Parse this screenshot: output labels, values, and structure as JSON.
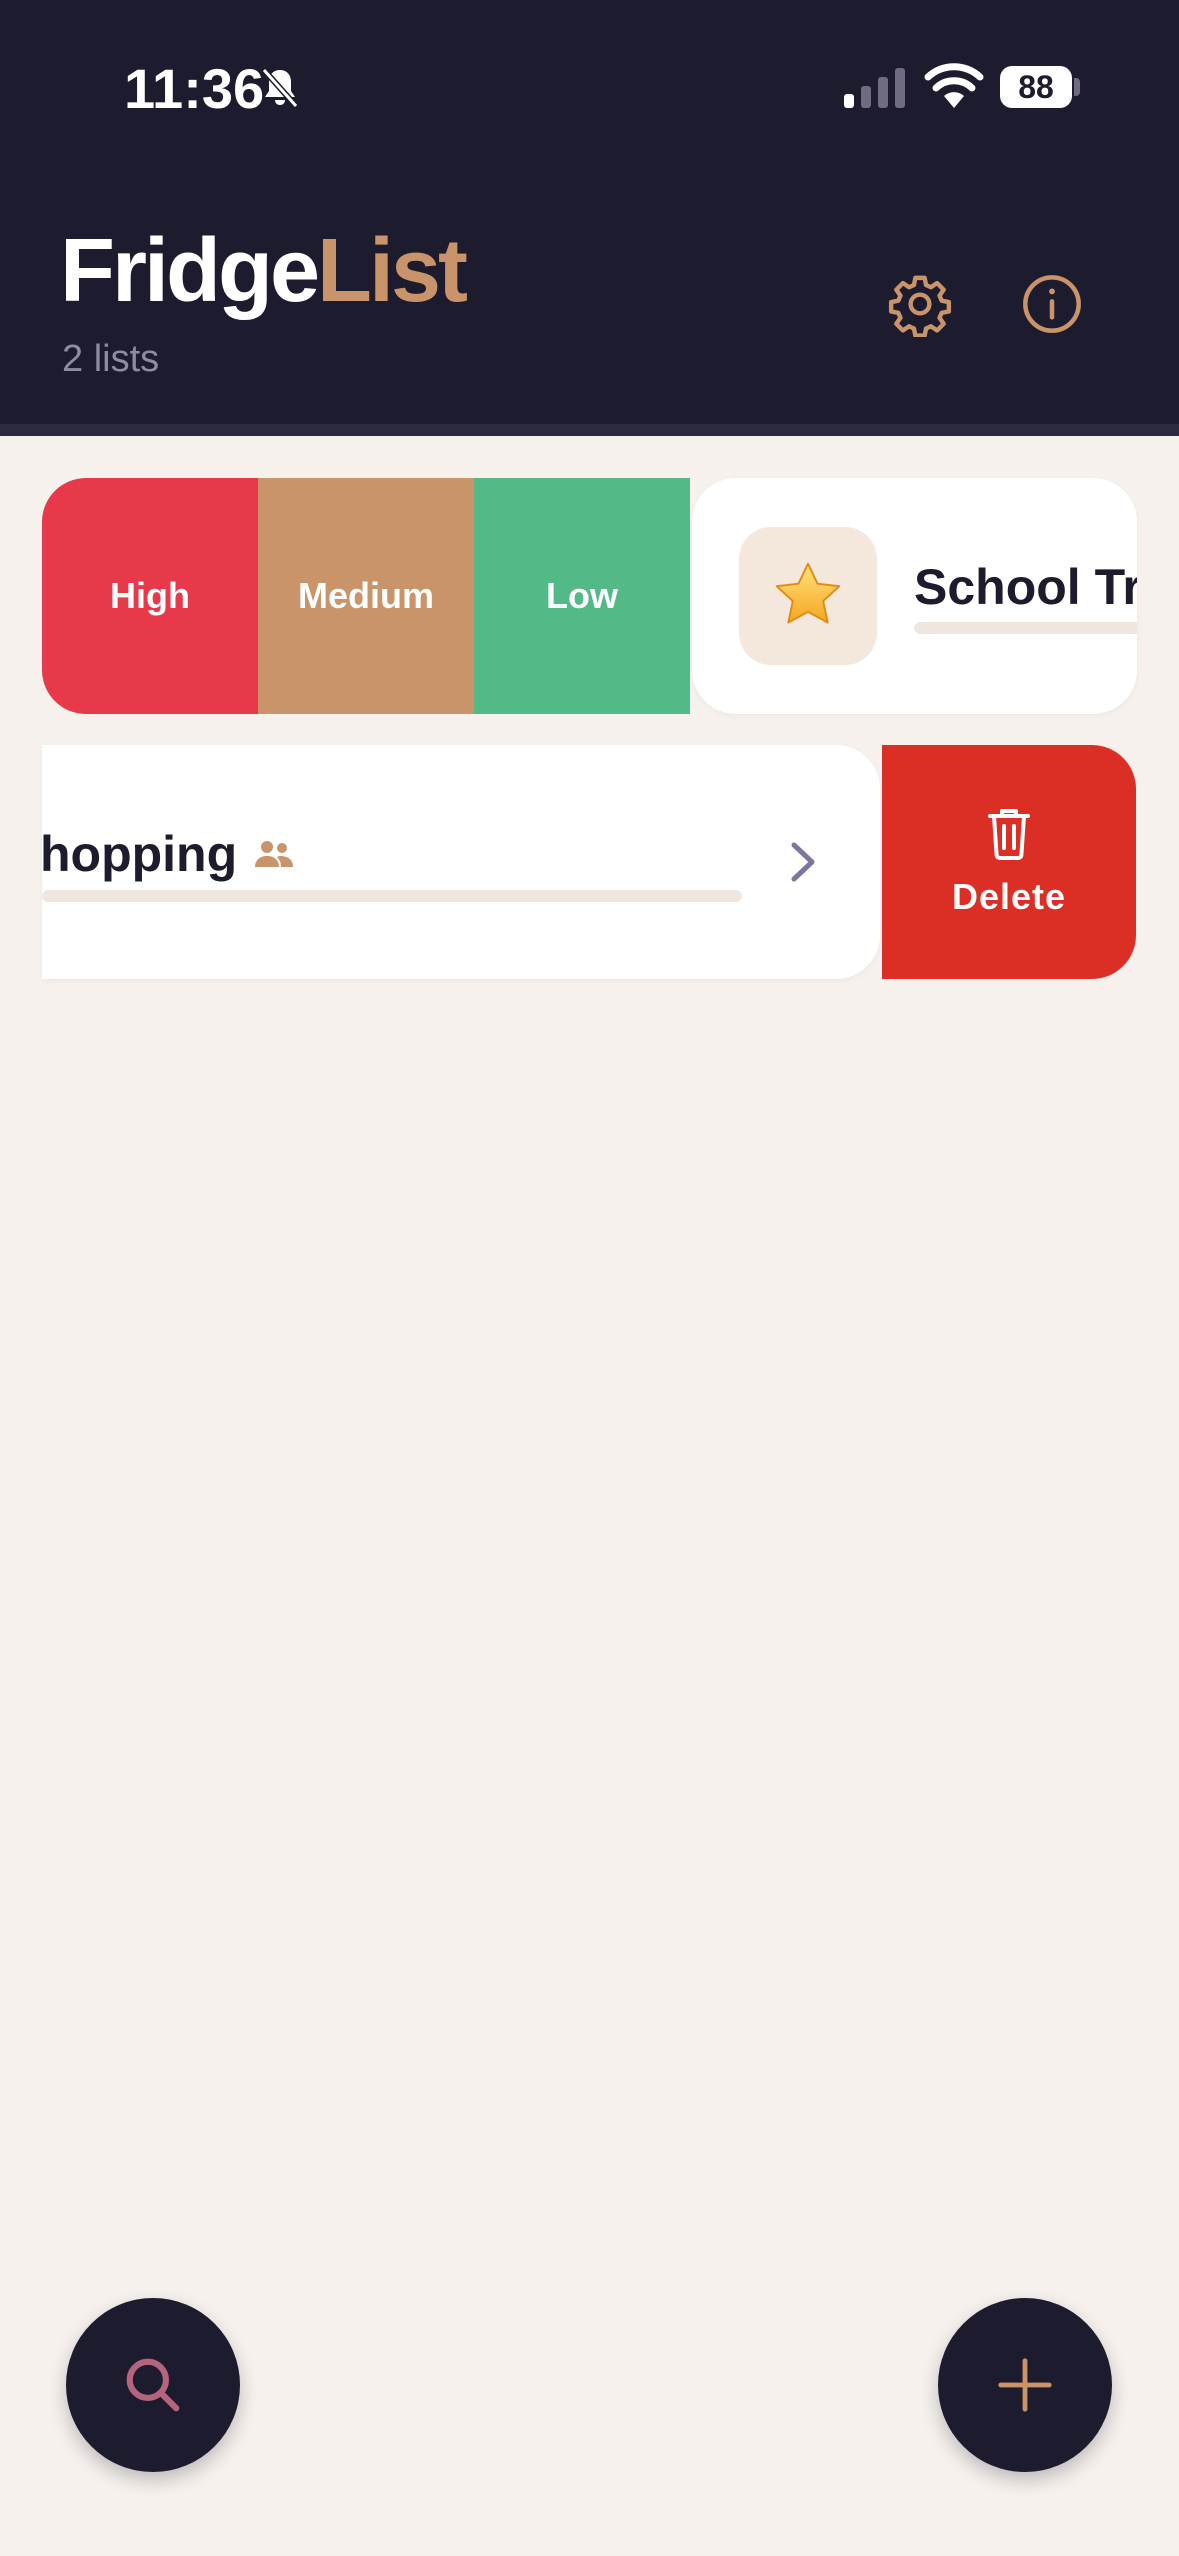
{
  "status_bar": {
    "time": "11:36",
    "battery": "88"
  },
  "header": {
    "title_part1": "Fridge",
    "title_part2": "List",
    "subtitle": "2 lists"
  },
  "lists": [
    {
      "emoji": "⭐",
      "title": "School Tri",
      "priority_actions": [
        "High",
        "Medium",
        "Low"
      ]
    },
    {
      "title": "hopping",
      "delete_label": "Delete"
    }
  ],
  "colors": {
    "header_bg": "#1D1B2E",
    "accent": "#C9946A",
    "high": "#E8394A",
    "medium": "#C9946A",
    "low": "#53B987",
    "delete": "#DB2F26",
    "background": "#F6F1EC"
  }
}
